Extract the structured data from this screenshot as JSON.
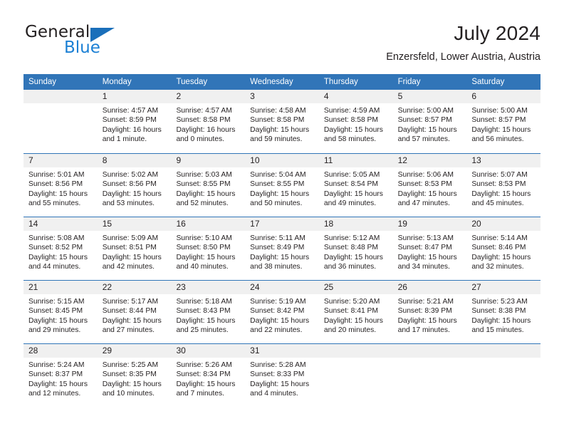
{
  "logo": {
    "word1": "General",
    "word2": "Blue",
    "triangle_color": "#1a6fba",
    "word2_color": "#1a7fd4"
  },
  "header": {
    "title": "July 2024",
    "subtitle": "Enzersfeld, Lower Austria, Austria"
  },
  "theme": {
    "header_blue": "#3175b8",
    "day_strip_gray": "#f0f0f0",
    "text_color": "#231f20"
  },
  "weekdays": [
    "Sunday",
    "Monday",
    "Tuesday",
    "Wednesday",
    "Thursday",
    "Friday",
    "Saturday"
  ],
  "weeks": [
    [
      {
        "day": "",
        "sunrise": "",
        "sunset": "",
        "daylight": ""
      },
      {
        "day": "1",
        "sunrise": "Sunrise: 4:57 AM",
        "sunset": "Sunset: 8:59 PM",
        "daylight": "Daylight: 16 hours and 1 minute."
      },
      {
        "day": "2",
        "sunrise": "Sunrise: 4:57 AM",
        "sunset": "Sunset: 8:58 PM",
        "daylight": "Daylight: 16 hours and 0 minutes."
      },
      {
        "day": "3",
        "sunrise": "Sunrise: 4:58 AM",
        "sunset": "Sunset: 8:58 PM",
        "daylight": "Daylight: 15 hours and 59 minutes."
      },
      {
        "day": "4",
        "sunrise": "Sunrise: 4:59 AM",
        "sunset": "Sunset: 8:58 PM",
        "daylight": "Daylight: 15 hours and 58 minutes."
      },
      {
        "day": "5",
        "sunrise": "Sunrise: 5:00 AM",
        "sunset": "Sunset: 8:57 PM",
        "daylight": "Daylight: 15 hours and 57 minutes."
      },
      {
        "day": "6",
        "sunrise": "Sunrise: 5:00 AM",
        "sunset": "Sunset: 8:57 PM",
        "daylight": "Daylight: 15 hours and 56 minutes."
      }
    ],
    [
      {
        "day": "7",
        "sunrise": "Sunrise: 5:01 AM",
        "sunset": "Sunset: 8:56 PM",
        "daylight": "Daylight: 15 hours and 55 minutes."
      },
      {
        "day": "8",
        "sunrise": "Sunrise: 5:02 AM",
        "sunset": "Sunset: 8:56 PM",
        "daylight": "Daylight: 15 hours and 53 minutes."
      },
      {
        "day": "9",
        "sunrise": "Sunrise: 5:03 AM",
        "sunset": "Sunset: 8:55 PM",
        "daylight": "Daylight: 15 hours and 52 minutes."
      },
      {
        "day": "10",
        "sunrise": "Sunrise: 5:04 AM",
        "sunset": "Sunset: 8:55 PM",
        "daylight": "Daylight: 15 hours and 50 minutes."
      },
      {
        "day": "11",
        "sunrise": "Sunrise: 5:05 AM",
        "sunset": "Sunset: 8:54 PM",
        "daylight": "Daylight: 15 hours and 49 minutes."
      },
      {
        "day": "12",
        "sunrise": "Sunrise: 5:06 AM",
        "sunset": "Sunset: 8:53 PM",
        "daylight": "Daylight: 15 hours and 47 minutes."
      },
      {
        "day": "13",
        "sunrise": "Sunrise: 5:07 AM",
        "sunset": "Sunset: 8:53 PM",
        "daylight": "Daylight: 15 hours and 45 minutes."
      }
    ],
    [
      {
        "day": "14",
        "sunrise": "Sunrise: 5:08 AM",
        "sunset": "Sunset: 8:52 PM",
        "daylight": "Daylight: 15 hours and 44 minutes."
      },
      {
        "day": "15",
        "sunrise": "Sunrise: 5:09 AM",
        "sunset": "Sunset: 8:51 PM",
        "daylight": "Daylight: 15 hours and 42 minutes."
      },
      {
        "day": "16",
        "sunrise": "Sunrise: 5:10 AM",
        "sunset": "Sunset: 8:50 PM",
        "daylight": "Daylight: 15 hours and 40 minutes."
      },
      {
        "day": "17",
        "sunrise": "Sunrise: 5:11 AM",
        "sunset": "Sunset: 8:49 PM",
        "daylight": "Daylight: 15 hours and 38 minutes."
      },
      {
        "day": "18",
        "sunrise": "Sunrise: 5:12 AM",
        "sunset": "Sunset: 8:48 PM",
        "daylight": "Daylight: 15 hours and 36 minutes."
      },
      {
        "day": "19",
        "sunrise": "Sunrise: 5:13 AM",
        "sunset": "Sunset: 8:47 PM",
        "daylight": "Daylight: 15 hours and 34 minutes."
      },
      {
        "day": "20",
        "sunrise": "Sunrise: 5:14 AM",
        "sunset": "Sunset: 8:46 PM",
        "daylight": "Daylight: 15 hours and 32 minutes."
      }
    ],
    [
      {
        "day": "21",
        "sunrise": "Sunrise: 5:15 AM",
        "sunset": "Sunset: 8:45 PM",
        "daylight": "Daylight: 15 hours and 29 minutes."
      },
      {
        "day": "22",
        "sunrise": "Sunrise: 5:17 AM",
        "sunset": "Sunset: 8:44 PM",
        "daylight": "Daylight: 15 hours and 27 minutes."
      },
      {
        "day": "23",
        "sunrise": "Sunrise: 5:18 AM",
        "sunset": "Sunset: 8:43 PM",
        "daylight": "Daylight: 15 hours and 25 minutes."
      },
      {
        "day": "24",
        "sunrise": "Sunrise: 5:19 AM",
        "sunset": "Sunset: 8:42 PM",
        "daylight": "Daylight: 15 hours and 22 minutes."
      },
      {
        "day": "25",
        "sunrise": "Sunrise: 5:20 AM",
        "sunset": "Sunset: 8:41 PM",
        "daylight": "Daylight: 15 hours and 20 minutes."
      },
      {
        "day": "26",
        "sunrise": "Sunrise: 5:21 AM",
        "sunset": "Sunset: 8:39 PM",
        "daylight": "Daylight: 15 hours and 17 minutes."
      },
      {
        "day": "27",
        "sunrise": "Sunrise: 5:23 AM",
        "sunset": "Sunset: 8:38 PM",
        "daylight": "Daylight: 15 hours and 15 minutes."
      }
    ],
    [
      {
        "day": "28",
        "sunrise": "Sunrise: 5:24 AM",
        "sunset": "Sunset: 8:37 PM",
        "daylight": "Daylight: 15 hours and 12 minutes."
      },
      {
        "day": "29",
        "sunrise": "Sunrise: 5:25 AM",
        "sunset": "Sunset: 8:35 PM",
        "daylight": "Daylight: 15 hours and 10 minutes."
      },
      {
        "day": "30",
        "sunrise": "Sunrise: 5:26 AM",
        "sunset": "Sunset: 8:34 PM",
        "daylight": "Daylight: 15 hours and 7 minutes."
      },
      {
        "day": "31",
        "sunrise": "Sunrise: 5:28 AM",
        "sunset": "Sunset: 8:33 PM",
        "daylight": "Daylight: 15 hours and 4 minutes."
      },
      {
        "day": "",
        "sunrise": "",
        "sunset": "",
        "daylight": ""
      },
      {
        "day": "",
        "sunrise": "",
        "sunset": "",
        "daylight": ""
      },
      {
        "day": "",
        "sunrise": "",
        "sunset": "",
        "daylight": ""
      }
    ]
  ]
}
